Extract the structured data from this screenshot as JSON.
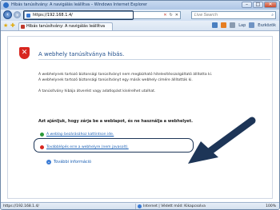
{
  "window": {
    "title": "Hibás tanúsítvány: A navigálás leállítva – Windows Internet Explorer",
    "controls": [
      "–",
      "□",
      "✕"
    ]
  },
  "address": {
    "url": "https://192.168.1.4/",
    "search_placeholder": "Live Search"
  },
  "tab": {
    "label": "Hibás tanúsítvány: A navigálás leállítva"
  },
  "toolbar": {
    "page_label": "Lap",
    "tools_label": "Eszközök"
  },
  "error": {
    "title": "A webhely tanúsítványa hibás.",
    "p1_line1": "A webhelynek tartozó biztonsági tanúsítványt nem megbízható hitelesítésszolgáltató állította ki.",
    "p1_line2": "A webhelynek tartozó biztonsági tanúsítványt egy másik webhely címére állították ki.",
    "p2": "A tanúsítvány hibája átverést vagy adatlopást kísérelhet utalhat.",
    "p3": "Azt ajánljuk, hogy zárja be a weblapot, és ne használja a webhelyet.",
    "option_close": "A weblap bezárásához kattintson ide.",
    "option_continue": "Továbblépés erre a webhelyre (nem javasolt).",
    "more_info": "További információ"
  },
  "status": {
    "text": "https://192.168.1.4/",
    "zone": "Internet | Védett mód: Kikapcsolva",
    "zoom": "100%"
  },
  "colors": {
    "link": "#1a5fb4",
    "error_title": "#1f4e8c",
    "shield": "#d8261f",
    "highlight": "#1d3557"
  }
}
